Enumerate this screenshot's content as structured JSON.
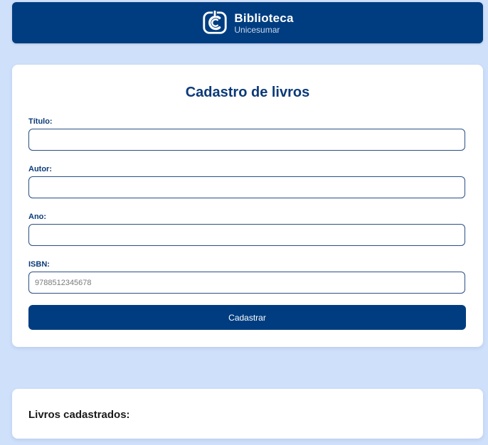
{
  "header": {
    "title": "Biblioteca",
    "subtitle": "Unicesumar",
    "logo_icon": "unicesumar-logo-icon"
  },
  "form": {
    "title": "Cadastro de livros",
    "fields": [
      {
        "label": "Título:",
        "value": "",
        "placeholder": ""
      },
      {
        "label": "Autor:",
        "value": "",
        "placeholder": ""
      },
      {
        "label": "Ano:",
        "value": "",
        "placeholder": ""
      },
      {
        "label": "ISBN:",
        "value": "",
        "placeholder": "9788512345678"
      }
    ],
    "submit_label": "Cadastrar"
  },
  "list": {
    "title": "Livros cadastrados:"
  },
  "colors": {
    "background": "#cfe0fb",
    "primary": "#003d80",
    "heading": "#0b3a78"
  }
}
